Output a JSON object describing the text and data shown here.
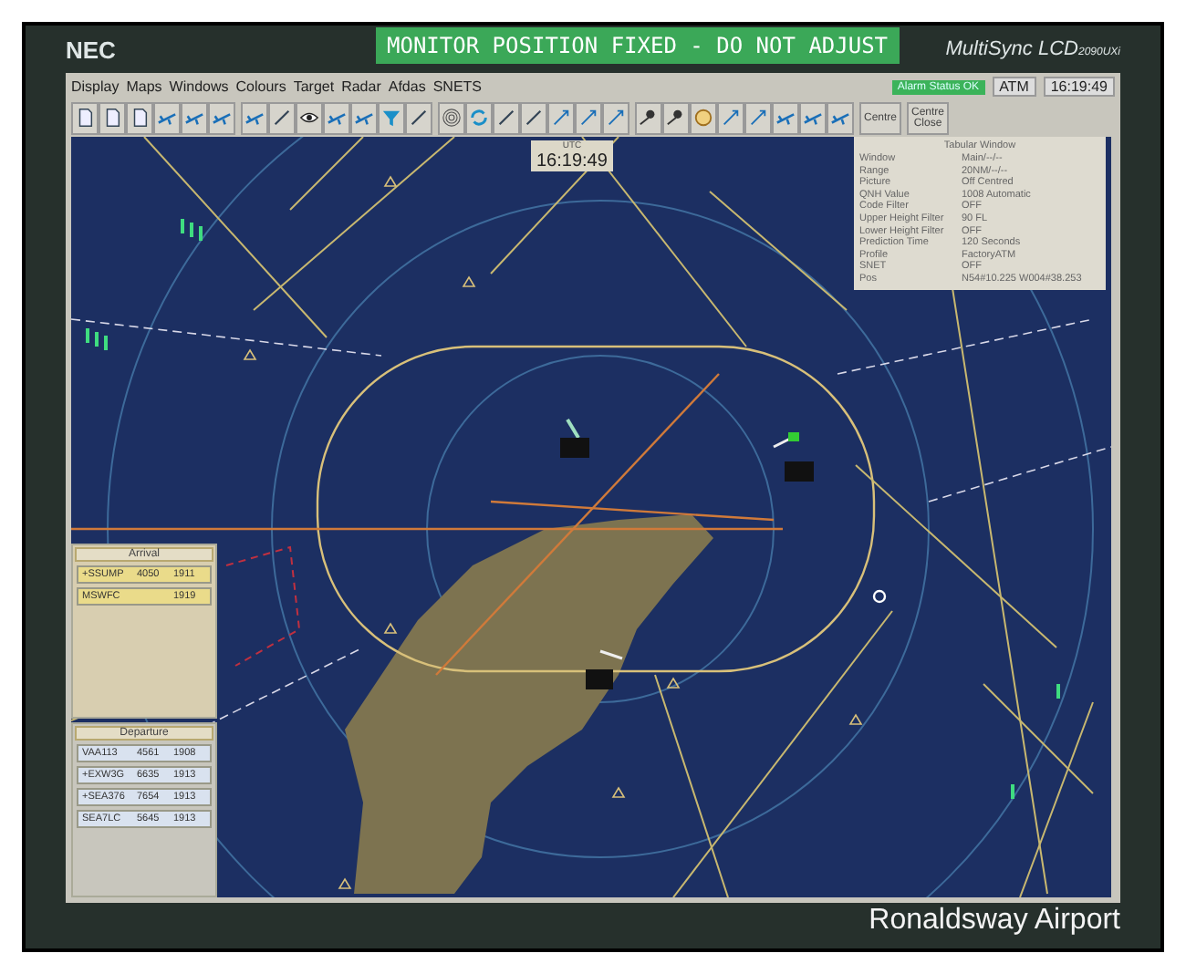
{
  "monitor": {
    "brand": "NEC",
    "model": "MultiSync LCD",
    "model_suffix": "2090UXi",
    "notice": "MONITOR POSITION FIXED - DO NOT ADJUST"
  },
  "menu": [
    "Display",
    "Maps",
    "Windows",
    "Colours",
    "Target",
    "Radar",
    "Afdas",
    "SNETS"
  ],
  "status": {
    "alarm": "Alarm Status OK",
    "mode": "ATM",
    "time": "16:19:49"
  },
  "toolbar_buttons": [
    "Centre",
    "Centre Close"
  ],
  "utc_clock": {
    "label": "UTC",
    "time": "16:19:49"
  },
  "tabular_window": {
    "title": "Tabular Window",
    "rows": [
      {
        "label": "Window",
        "value": "Main/--/--"
      },
      {
        "label": "Range",
        "value": "20NM/--/--"
      },
      {
        "label": "Picture",
        "value": "Off Centred"
      },
      {
        "label": "QNH Value",
        "value": "1008 Automatic"
      },
      {
        "label": "Code Filter",
        "value": "OFF"
      },
      {
        "label": "Upper Height Filter",
        "value": "90 FL"
      },
      {
        "label": "Lower Height Filter",
        "value": "OFF"
      },
      {
        "label": "Prediction Time",
        "value": "120 Seconds"
      },
      {
        "label": "Profile",
        "value": "FactoryATM"
      },
      {
        "label": "SNET",
        "value": "OFF"
      },
      {
        "label": "Pos",
        "value": "N54#10.225  W004#38.253"
      }
    ]
  },
  "arrival": {
    "title": "Arrival",
    "rows": [
      {
        "callsign": "+SSUMP",
        "code": "4050",
        "time": "1911"
      },
      {
        "callsign": "MSWFC",
        "code": "",
        "time": "1919"
      }
    ]
  },
  "departure": {
    "title": "Departure",
    "rows": [
      {
        "callsign": "VAA113",
        "code": "4561",
        "time": "1908"
      },
      {
        "callsign": "+EXW3G",
        "code": "6635",
        "time": "1913"
      },
      {
        "callsign": "+SEA376",
        "code": "7654",
        "time": "1913"
      },
      {
        "callsign": "SEA7LC",
        "code": "5645",
        "time": "1913"
      }
    ]
  },
  "caption": "Ronaldsway Airport"
}
